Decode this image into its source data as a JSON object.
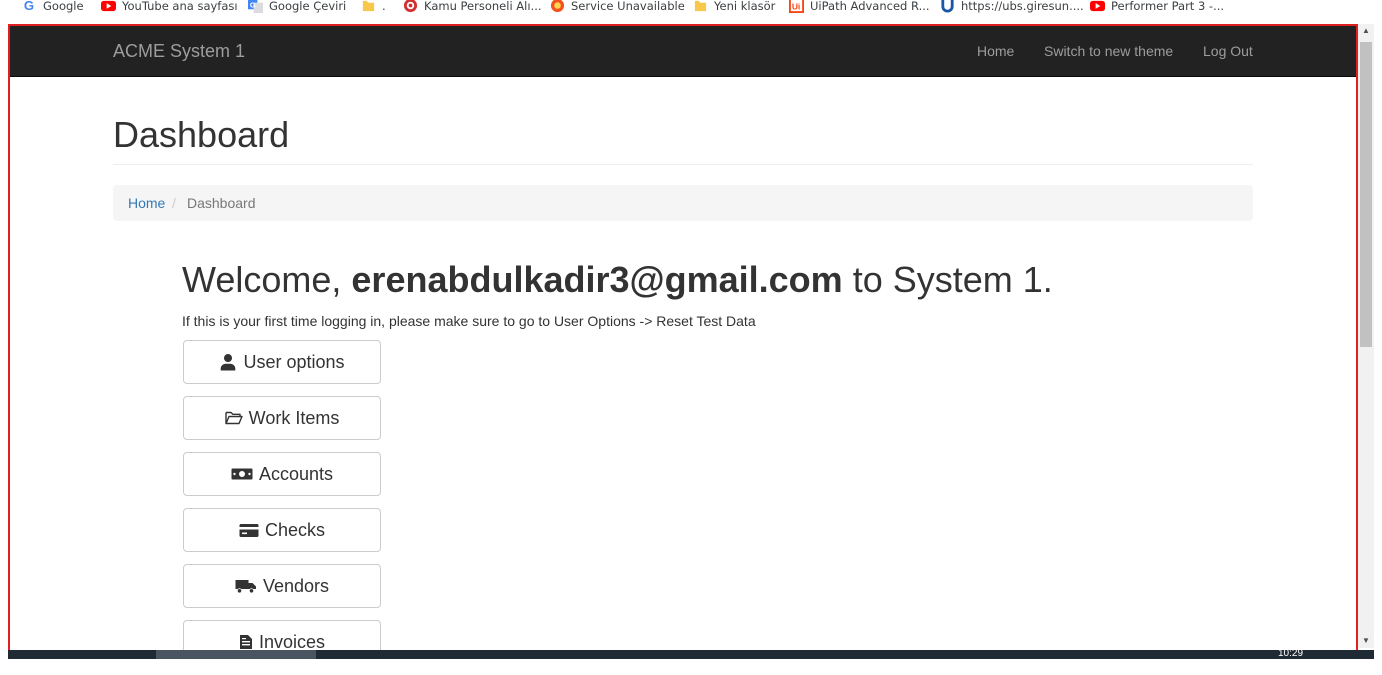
{
  "bookmarks": [
    {
      "label": "Google",
      "icon": "google-icon"
    },
    {
      "label": "YouTube ana sayfası",
      "icon": "youtube-icon"
    },
    {
      "label": "Google Çeviri",
      "icon": "translate-icon"
    },
    {
      "label": ".",
      "icon": "folder-icon"
    },
    {
      "label": "Kamu Personeli Alı...",
      "icon": "kamu-icon"
    },
    {
      "label": "Service Unavailable",
      "icon": "service-icon"
    },
    {
      "label": "Yeni klasör",
      "icon": "folder-icon"
    },
    {
      "label": "UiPath Advanced R...",
      "icon": "uipath-icon"
    },
    {
      "label": "https://ubs.giresun....",
      "icon": "ubs-icon"
    },
    {
      "label": "Performer Part 3 -...",
      "icon": "youtube-icon"
    }
  ],
  "navbar": {
    "brand": "ACME System 1",
    "links": {
      "home": "Home",
      "theme": "Switch to new theme",
      "logout": "Log Out"
    }
  },
  "page": {
    "title": "Dashboard"
  },
  "breadcrumb": {
    "home": "Home",
    "separator": "/",
    "current": "Dashboard"
  },
  "welcome": {
    "prefix": "Welcome,",
    "email": "erenabdulkadir3@gmail.com",
    "suffix": "to System 1.",
    "hint": "If this is your first time logging in, please make sure to go to User Options -> Reset Test Data"
  },
  "menu": [
    {
      "label": "User options",
      "icon": "user-icon"
    },
    {
      "label": "Work Items",
      "icon": "folder-open-icon"
    },
    {
      "label": "Accounts",
      "icon": "money-bill-icon"
    },
    {
      "label": "Checks",
      "icon": "credit-card-icon"
    },
    {
      "label": "Vendors",
      "icon": "truck-icon"
    },
    {
      "label": "Invoices",
      "icon": "file-invoice-icon"
    }
  ],
  "taskbar": {
    "clock": "10:29"
  },
  "colors": {
    "navbar_bg": "#222222",
    "navbar_text": "#9d9d9d",
    "link": "#337ab7",
    "frame_border": "#e02020"
  }
}
